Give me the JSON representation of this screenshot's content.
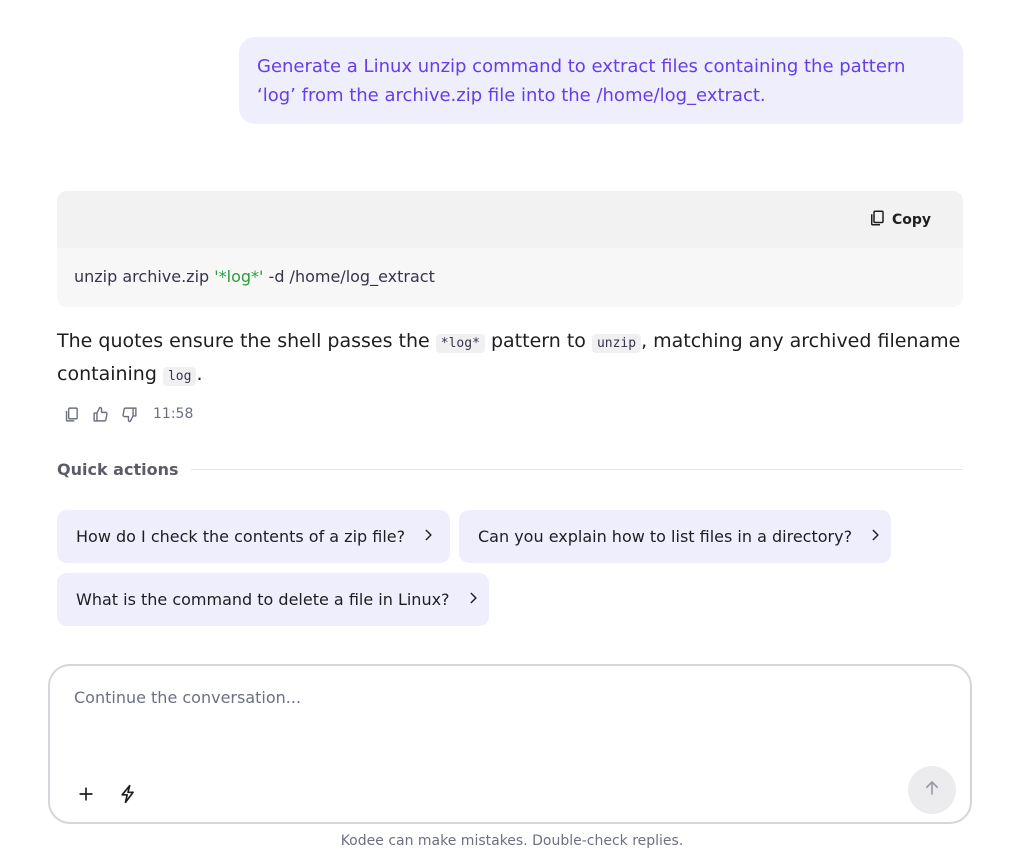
{
  "user_message": "Generate a Linux unzip command to extract files containing the pattern ‘log’ from the archive.zip file into the /home/log_extract.",
  "code_block": {
    "copy_label": "Copy",
    "cmd_part1": "unzip archive.zip ",
    "cmd_string": "'*log*'",
    "cmd_part2": " -d /home/log_extract",
    "string_color": "#2a9d3a"
  },
  "answer": {
    "text_1": "The quotes ensure the shell passes the ",
    "code_1": "*log*",
    "text_2": " pattern to ",
    "code_2": "unzip",
    "text_3": ", matching any archived filename containing ",
    "code_3": "log",
    "text_4": "."
  },
  "message_actions": {
    "time": "11:58",
    "icons": [
      "copy-icon",
      "thumbs-up-icon",
      "thumbs-down-icon"
    ]
  },
  "quick_actions": {
    "title": "Quick actions",
    "items": [
      "How do I check the contents of a zip file?",
      "Can you explain how to list files in a directory?",
      "What is the command to delete a file in Linux?"
    ]
  },
  "composer": {
    "placeholder": "Continue the conversation...",
    "value": ""
  },
  "disclaimer": "Kodee can make mistakes. Double-check replies.",
  "colors": {
    "accent": "#673de6",
    "bubble_bg": "#efeefd"
  }
}
